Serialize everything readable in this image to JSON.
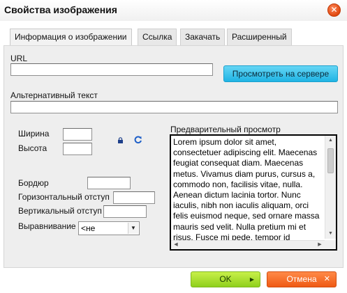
{
  "dialog": {
    "title": "Свойства изображения",
    "close_glyph": "✕"
  },
  "tabs": [
    {
      "label": "Информация о изображении",
      "active": true
    },
    {
      "label": "Ссылка",
      "active": false
    },
    {
      "label": "Закачать",
      "active": false
    },
    {
      "label": "Расширенный",
      "active": false
    }
  ],
  "form": {
    "url_label": "URL",
    "url_value": "",
    "browse_button": "Просмотреть на сервере",
    "alt_label": "Альтернативный текст",
    "alt_value": "",
    "width_label": "Ширина",
    "width_value": "",
    "height_label": "Высота",
    "height_value": "",
    "border_label": "Бордюр",
    "border_value": "",
    "hspace_label": "Горизонтальный отступ",
    "hspace_value": "",
    "vspace_label": "Вертикальный отступ",
    "vspace_value": "",
    "align_label": "Выравнивание",
    "align_selected": "<не определено>",
    "icons": {
      "lock": "lock-icon",
      "reset": "reset-size-icon"
    }
  },
  "preview": {
    "label": "Предварительный просмотр",
    "text": "Lorem ipsum dolor sit amet, consectetuer adipiscing elit. Maecenas feugiat consequat diam. Maecenas metus. Vivamus diam purus, cursus a, commodo non, facilisis vitae, nulla. Aenean dictum lacinia tortor. Nunc iaculis, nibh non iaculis aliquam, orci felis euismod neque, sed ornare massa mauris sed velit. Nulla pretium mi et risus. Fusce mi pede, tempor id"
  },
  "footer": {
    "ok_label": "OK",
    "cancel_label": "Отмена"
  },
  "colors": {
    "ok_button": "#9ad62a",
    "cancel_button": "#f26522",
    "browse_button": "#2bbbe8",
    "panel_bg": "#eeeeee"
  }
}
